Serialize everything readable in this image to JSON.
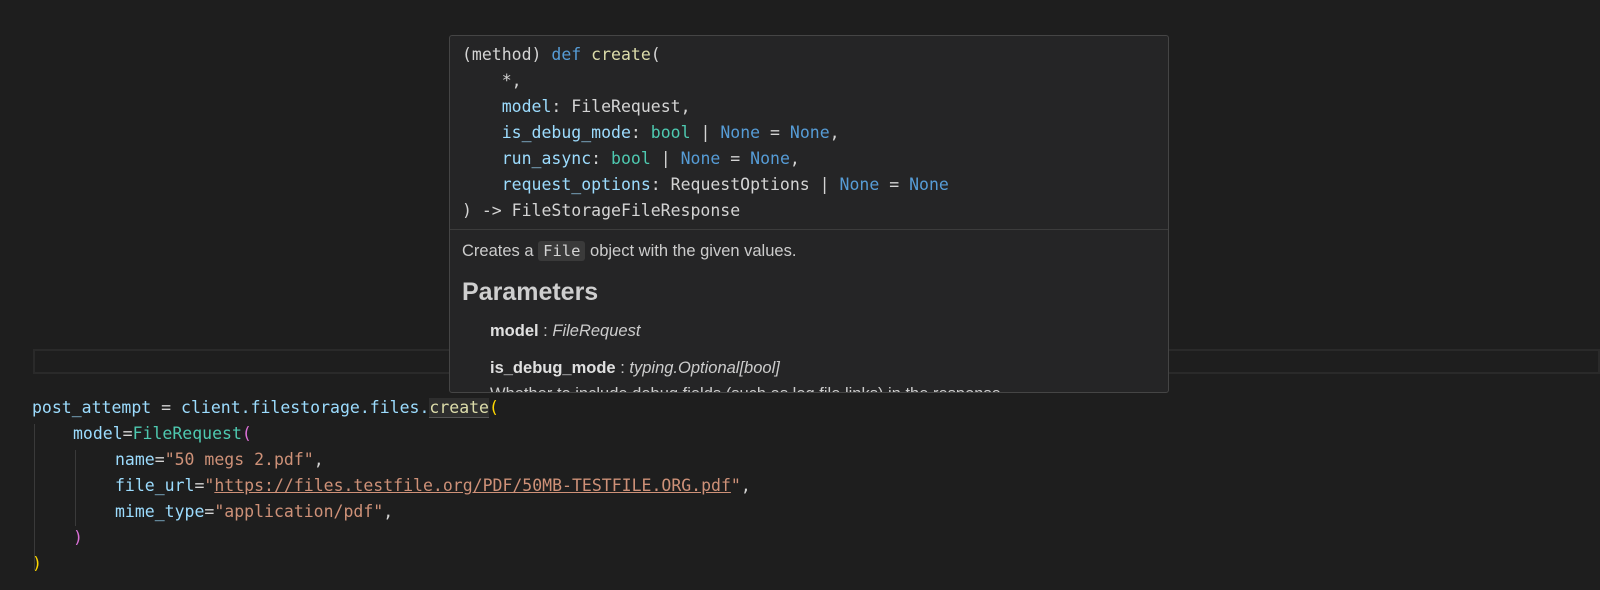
{
  "editor": {
    "lines": [
      {
        "var": "post_attempt",
        "op": " = ",
        "obj": "client.filestorage.files.",
        "fn": "create",
        "paren": "("
      },
      {
        "arg": "model",
        "eq": "=",
        "cls": "FileRequest",
        "paren": "("
      },
      {
        "arg": "name",
        "eq": "=",
        "str": "\"50 megs 2.pdf\"",
        "comma": ","
      },
      {
        "arg": "file_url",
        "eq": "=",
        "q1": "\"",
        "link": "https://files.testfile.org/PDF/50MB-TESTFILE.ORG.pdf",
        "q2": "\"",
        "comma": ","
      },
      {
        "arg": "mime_type",
        "eq": "=",
        "str": "\"application/pdf\"",
        "comma": ","
      },
      {
        "paren": ")"
      },
      {
        "paren": ")"
      }
    ]
  },
  "hover": {
    "signature": {
      "prefix": "(method) ",
      "kw": "def",
      "name": "create",
      "open": "(",
      "star": "*,",
      "params": [
        {
          "name": "model",
          "sep": ": ",
          "type": "FileRequest",
          "rest": ","
        },
        {
          "name": "is_debug_mode",
          "sep": ": ",
          "type": "bool",
          "bar": " | ",
          "none1": "None",
          "eq": " = ",
          "none2": "None",
          "rest": ","
        },
        {
          "name": "run_async",
          "sep": ": ",
          "type": "bool",
          "bar": " | ",
          "none1": "None",
          "eq": " = ",
          "none2": "None",
          "rest": ","
        },
        {
          "name": "request_options",
          "sep": ": ",
          "type": "RequestOptions",
          "bar": " | ",
          "none1": "None",
          "eq": " = ",
          "none2": "None",
          "rest": ""
        }
      ],
      "close": ") -> ",
      "returns": "FileStorageFileResponse"
    },
    "description": {
      "before": "Creates a ",
      "code": "File",
      "after": " object with the given values."
    },
    "params_heading": "Parameters",
    "param_docs": [
      {
        "name": "model",
        "sep": " : ",
        "type": "FileRequest"
      },
      {
        "name": "is_debug_mode",
        "sep": " : ",
        "type": "typing.Optional[bool]"
      }
    ],
    "truncated_text": "Whether to include debug fields (such as log file links) in the response."
  },
  "colors": {
    "background": "#1e1e1e",
    "hover_bg": "#252526",
    "variable": "#9cdcfe",
    "function": "#dcdcaa",
    "class": "#4ec9b0",
    "string": "#ce9178",
    "keyword": "#569cd6"
  }
}
